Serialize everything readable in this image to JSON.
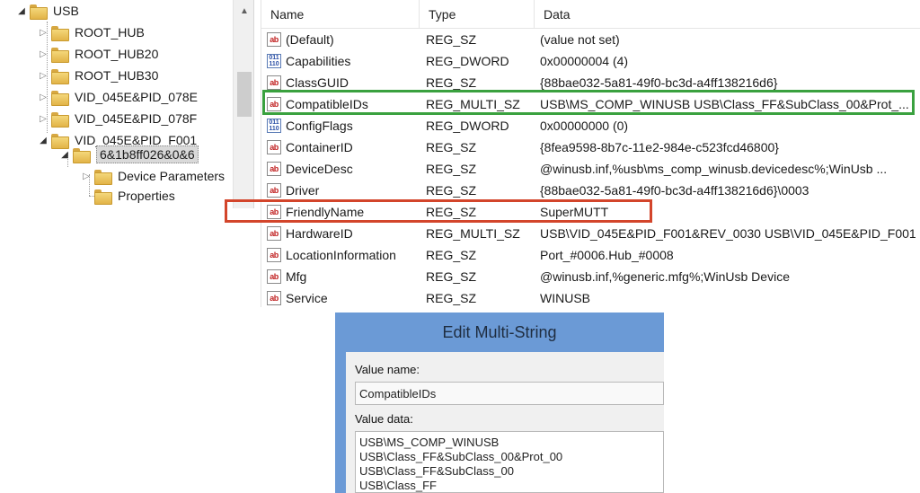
{
  "tree": {
    "items": [
      {
        "label": "USB",
        "expanded": true
      },
      {
        "label": "ROOT_HUB"
      },
      {
        "label": "ROOT_HUB20"
      },
      {
        "label": "ROOT_HUB30"
      },
      {
        "label": "VID_045E&PID_078E"
      },
      {
        "label": "VID_045E&PID_078F"
      },
      {
        "label": "VID_045E&PID_F001",
        "expanded": true
      },
      {
        "label": "6&1b8ff026&0&6",
        "expanded": true,
        "selected": true
      },
      {
        "label": "Device Parameters"
      },
      {
        "label": "Properties"
      }
    ]
  },
  "list": {
    "columns": {
      "name": "Name",
      "type": "Type",
      "data": "Data"
    },
    "rows": [
      {
        "icon": "string-value-icon",
        "name": "(Default)",
        "type": "REG_SZ",
        "data": "(value not set)"
      },
      {
        "icon": "binary-value-icon",
        "name": "Capabilities",
        "type": "REG_DWORD",
        "data": "0x00000004 (4)"
      },
      {
        "icon": "string-value-icon",
        "name": "ClassGUID",
        "type": "REG_SZ",
        "data": "{88bae032-5a81-49f0-bc3d-a4ff138216d6}"
      },
      {
        "icon": "string-value-icon",
        "name": "CompatibleIDs",
        "type": "REG_MULTI_SZ",
        "data": "USB\\MS_COMP_WINUSB USB\\Class_FF&SubClass_00&Prot_..."
      },
      {
        "icon": "binary-value-icon",
        "name": "ConfigFlags",
        "type": "REG_DWORD",
        "data": "0x00000000 (0)"
      },
      {
        "icon": "string-value-icon",
        "name": "ContainerID",
        "type": "REG_SZ",
        "data": "{8fea9598-8b7c-11e2-984e-c523fcd46800}"
      },
      {
        "icon": "string-value-icon",
        "name": "DeviceDesc",
        "type": "REG_SZ",
        "data": "@winusb.inf,%usb\\ms_comp_winusb.devicedesc%;WinUsb ..."
      },
      {
        "icon": "string-value-icon",
        "name": "Driver",
        "type": "REG_SZ",
        "data": "{88bae032-5a81-49f0-bc3d-a4ff138216d6}\\0003"
      },
      {
        "icon": "string-value-icon",
        "name": "FriendlyName",
        "type": "REG_SZ",
        "data": "SuperMUTT"
      },
      {
        "icon": "string-value-icon",
        "name": "HardwareID",
        "type": "REG_MULTI_SZ",
        "data": "USB\\VID_045E&PID_F001&REV_0030 USB\\VID_045E&PID_F001"
      },
      {
        "icon": "string-value-icon",
        "name": "LocationInformation",
        "type": "REG_SZ",
        "data": "Port_#0006.Hub_#0008"
      },
      {
        "icon": "string-value-icon",
        "name": "Mfg",
        "type": "REG_SZ",
        "data": "@winusb.inf,%generic.mfg%;WinUsb Device"
      },
      {
        "icon": "string-value-icon",
        "name": "Service",
        "type": "REG_SZ",
        "data": "WINUSB"
      }
    ]
  },
  "icons": {
    "string": "ab",
    "binary_top": "011",
    "binary_bottom": "110"
  },
  "dialog": {
    "title": "Edit Multi-String",
    "value_name_label": "Value name:",
    "value_name": "CompatibleIDs",
    "value_data_label": "Value data:",
    "value_data_lines": [
      "USB\\MS_COMP_WINUSB",
      "USB\\Class_FF&SubClass_00&Prot_00",
      "USB\\Class_FF&SubClass_00",
      "USB\\Class_FF"
    ]
  },
  "colors": {
    "highlight_green": "#3aa13f",
    "highlight_red": "#d3452b",
    "dialog_title_bar": "#6b9ad6"
  }
}
